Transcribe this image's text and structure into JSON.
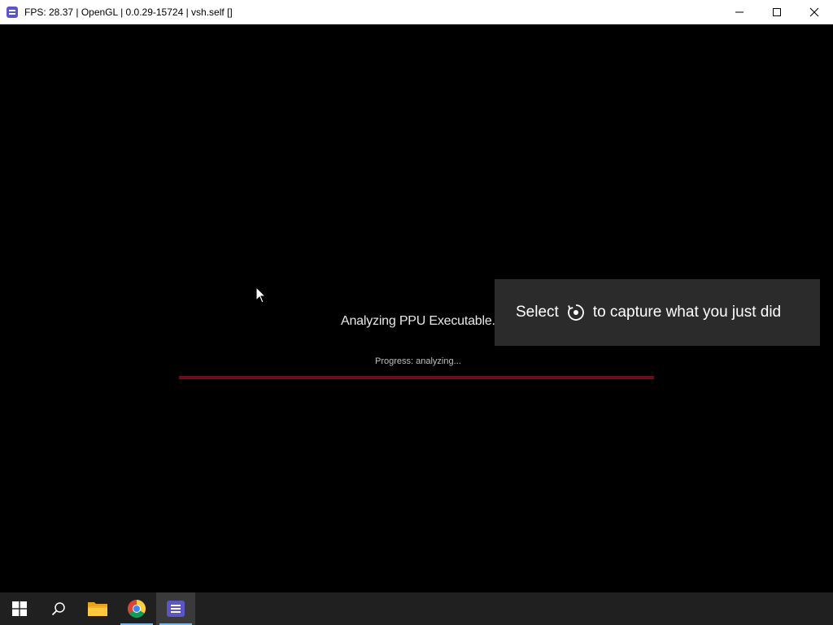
{
  "window": {
    "title": "FPS: 28.37 | OpenGL | 0.0.29-15724 | vsh.self []"
  },
  "loader": {
    "status": "Analyzing PPU Executable...",
    "progress_text": "Progress: analyzing...",
    "progress_fraction": 0.0,
    "progress_color": "#6b0d19"
  },
  "toast": {
    "text_before": "Select",
    "icon": "capture-icon",
    "text_after": "to capture what you just did"
  },
  "taskbar": {
    "items": [
      {
        "name": "start",
        "icon": "windows-start-icon"
      },
      {
        "name": "search",
        "icon": "search-icon"
      },
      {
        "name": "file-explorer",
        "icon": "folder-icon"
      },
      {
        "name": "chrome",
        "icon": "chrome-icon"
      },
      {
        "name": "rpcs3",
        "icon": "rpcs3-icon"
      }
    ]
  }
}
